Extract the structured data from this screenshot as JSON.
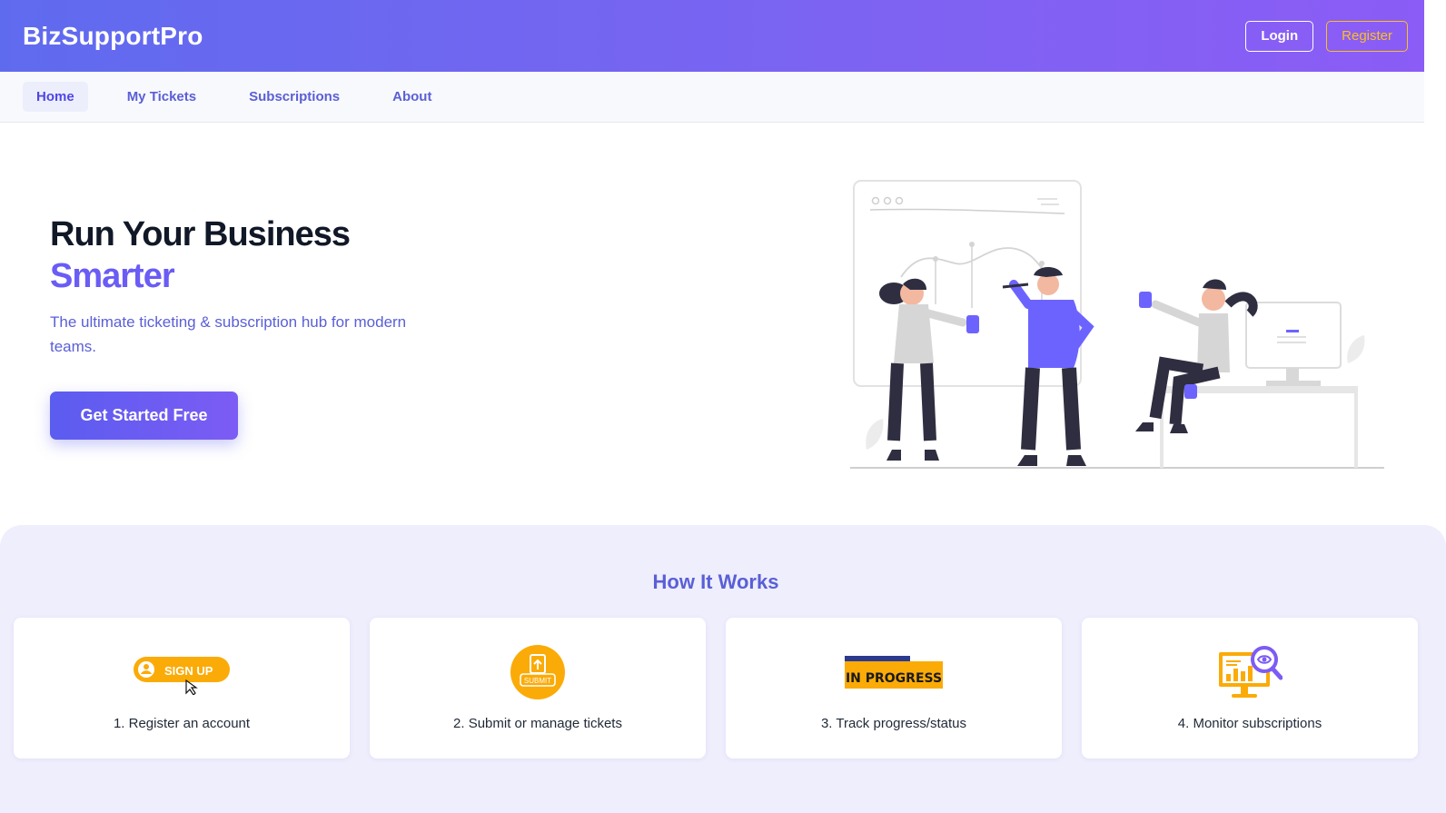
{
  "header": {
    "brand": "BizSupportPro",
    "login_label": "Login",
    "register_label": "Register"
  },
  "nav": {
    "items": [
      {
        "label": "Home",
        "active": true
      },
      {
        "label": "My Tickets",
        "active": false
      },
      {
        "label": "Subscriptions",
        "active": false
      },
      {
        "label": "About",
        "active": false
      }
    ]
  },
  "hero": {
    "title_line1": "Run Your Business",
    "title_line2": "Smarter",
    "subtitle": "The ultimate ticketing & subscription hub for modern teams.",
    "cta_label": "Get Started Free"
  },
  "how_it_works": {
    "title": "How It Works",
    "steps": [
      {
        "label": "1. Register an account",
        "icon": "sign-up-icon",
        "icon_text": "SIGN UP"
      },
      {
        "label": "2. Submit or manage tickets",
        "icon": "submit-icon",
        "icon_text": "SUBMIT"
      },
      {
        "label": "3. Track progress/status",
        "icon": "in-progress-icon",
        "icon_text": "IN PROGRESS"
      },
      {
        "label": "4. Monitor subscriptions",
        "icon": "monitor-analytics-icon",
        "icon_text": ""
      }
    ]
  },
  "colors": {
    "brand_gradient_start": "#5f6bef",
    "brand_gradient_end": "#8b5cf6",
    "accent": "#6a5cf5",
    "register_border": "#fbbf24",
    "section_bg": "#eeeefd",
    "icon_orange": "#fbab07"
  }
}
